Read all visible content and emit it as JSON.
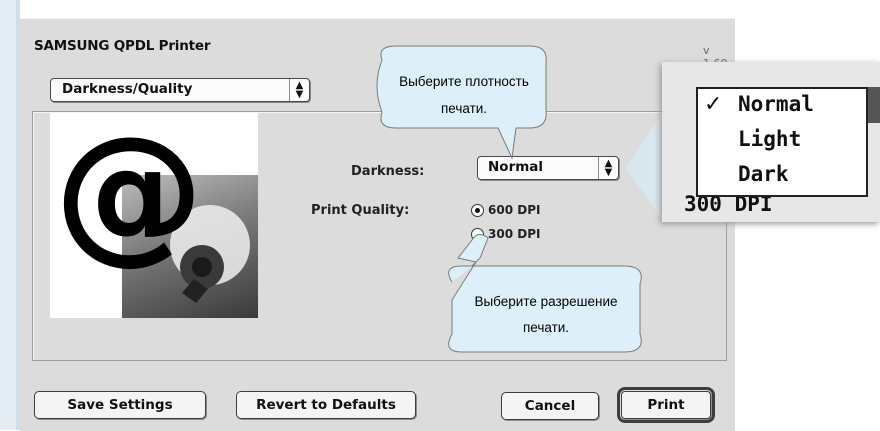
{
  "dialog": {
    "title": "SAMSUNG QPDL Printer",
    "version": "v 1.60",
    "section_popup": "Darkness/Quality",
    "darkness_label": "Darkness:",
    "darkness_value": "Normal",
    "print_quality_label": "Print Quality:",
    "quality_options": [
      "600 DPI",
      "300 DPI"
    ],
    "quality_selected": "600 DPI"
  },
  "buttons": {
    "save": "Save Settings",
    "revert": "Revert to Defaults",
    "cancel": "Cancel",
    "print": "Print"
  },
  "callouts": {
    "darkness_line1": "Выберите плотность",
    "darkness_line2": "печати.",
    "resolution_line1": "Выберите разрешение",
    "resolution_line2": "печати."
  },
  "zoom_menu": {
    "items": [
      "Normal",
      "Light",
      "Dark"
    ],
    "checked": "Normal",
    "behind_text": "300 DPI"
  },
  "colors": {
    "dialog_bg": "#dcdcdc",
    "callout_fill": "#ddf0fa",
    "callout_stroke": "#7a7a7a",
    "side_stripe": "#e3edf3"
  },
  "icons": [
    "updown-arrows-icon",
    "checkmark-icon",
    "radio-selected-icon",
    "radio-empty-icon"
  ]
}
